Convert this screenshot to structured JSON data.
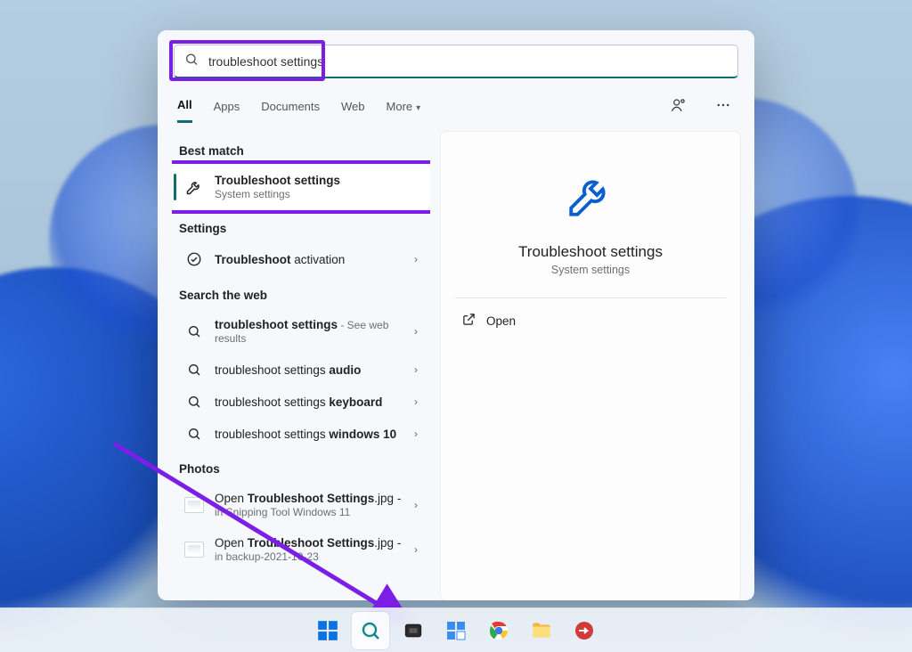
{
  "search": {
    "value": "troubleshoot settings"
  },
  "tabs": {
    "all": "All",
    "apps": "Apps",
    "documents": "Documents",
    "web": "Web",
    "more": "More"
  },
  "sections": {
    "best_match": "Best match",
    "settings": "Settings",
    "search_web": "Search the web",
    "photos": "Photos"
  },
  "best_match": {
    "title": "Troubleshoot settings",
    "subtitle": "System settings"
  },
  "settings_items": {
    "0": {
      "title_a": "Troubleshoot",
      "title_b": " activation"
    }
  },
  "web_items": {
    "0": {
      "title_a": "troubleshoot settings",
      "suffix": " - See web results"
    },
    "1": {
      "title_a": "troubleshoot settings ",
      "title_b": "audio"
    },
    "2": {
      "title_a": "troubleshoot settings ",
      "title_b": "keyboard"
    },
    "3": {
      "title_a": "troubleshoot settings ",
      "title_b": "windows 10"
    }
  },
  "photo_items": {
    "0": {
      "title_a": "Open ",
      "title_b": "Troubleshoot Settings",
      "title_c": ".jpg -",
      "sub": "in Snipping Tool Windows 11"
    },
    "1": {
      "title_a": "Open ",
      "title_b": "Troubleshoot Settings",
      "title_c": ".jpg -",
      "sub": "in backup-2021-10-23"
    }
  },
  "preview": {
    "title": "Troubleshoot settings",
    "subtitle": "System settings",
    "open": "Open"
  }
}
